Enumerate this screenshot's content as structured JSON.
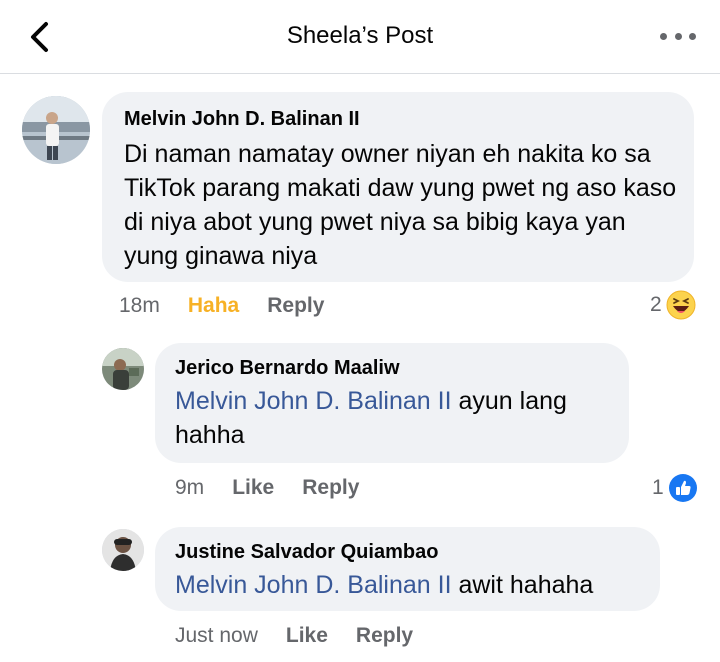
{
  "header": {
    "title": "Sheela’s Post"
  },
  "comments": [
    {
      "author": "Melvin John D. Balinan II",
      "text": "Di naman namatay owner niyan eh nakita ko sa TikTok parang makati daw yung pwet ng aso kaso di niya abot yung pwet niya sa bibig kaya yan yung ginawa niya",
      "time": "18m",
      "reaction_label": "Haha",
      "reply_label": "Reply",
      "reaction_count": "2",
      "reaction_icon": "haha-emoji-icon",
      "colors": {
        "reaction_label": "#f7b125"
      }
    },
    {
      "author": "Jerico Bernardo Maaliw",
      "mention": "Melvin John D. Balinan II",
      "text": " ayun lang hahha",
      "time": "9m",
      "reaction_label": "Like",
      "reply_label": "Reply",
      "reaction_count": "1",
      "reaction_icon": "like-thumb-icon"
    },
    {
      "author": "Justine Salvador Quiambao",
      "mention": "Melvin John D. Balinan II",
      "text": " awit hahaha",
      "time": "Just now",
      "reaction_label": "Like",
      "reply_label": "Reply"
    }
  ],
  "colors": {
    "mention": "#385898",
    "bubble": "#f0f2f5",
    "like_blue": "#1877f2"
  }
}
